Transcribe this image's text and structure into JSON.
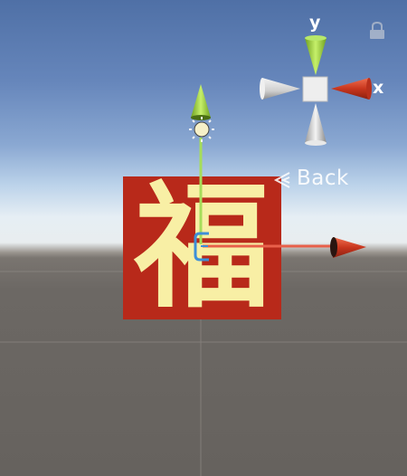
{
  "scene_view": {
    "back_label": "Back",
    "sprite_text": "福",
    "gizmo": {
      "y_label": "y",
      "x_label": "x"
    }
  },
  "colors": {
    "sky_top": "#4f70a6",
    "horizon": "#e8edef",
    "ground": "#66625e",
    "sprite_background": "#b8291a",
    "sprite_glyph": "#f8efa5",
    "y_axis": "#9ccc3c",
    "x_axis": "#e0442a",
    "gizmo_center": "#eeeeee"
  },
  "icons": {
    "lock": "lock-icon",
    "light": "directional-light-icon",
    "camera_back": "chevron-left-icon"
  }
}
